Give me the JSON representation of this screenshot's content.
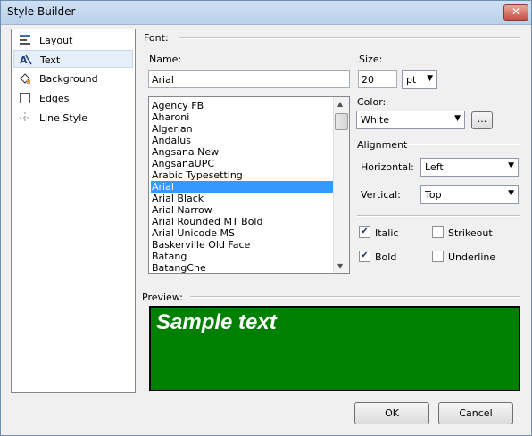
{
  "window": {
    "title": "Style Builder",
    "close_label": "✕"
  },
  "sidebar": {
    "items": [
      {
        "label": "Layout"
      },
      {
        "label": "Text"
      },
      {
        "label": "Background"
      },
      {
        "label": "Edges"
      },
      {
        "label": "Line Style"
      }
    ]
  },
  "font": {
    "group_label": "Font:",
    "name_label": "Name:",
    "name_value": "Arial",
    "size_label": "Size:",
    "size_value": "20",
    "unit_value": "pt",
    "list": [
      "Agency FB",
      "Aharoni",
      "Algerian",
      "Andalus",
      "Angsana New",
      "AngsanaUPC",
      "Arabic Typesetting",
      "Arial",
      "Arial Black",
      "Arial Narrow",
      "Arial Rounded MT Bold",
      "Arial Unicode MS",
      "Baskerville Old Face",
      "Batang",
      "BatangChe"
    ],
    "selected": "Arial"
  },
  "color": {
    "label": "Color:",
    "value": "White",
    "browse_label": "..."
  },
  "alignment": {
    "label": "Alignment",
    "horizontal_label": "Horizontal:",
    "horizontal_value": "Left",
    "vertical_label": "Vertical:",
    "vertical_value": "Top"
  },
  "styles": {
    "italic": {
      "label": "Italic",
      "checked": true
    },
    "strikeout": {
      "label": "Strikeout",
      "checked": false
    },
    "bold": {
      "label": "Bold",
      "checked": true
    },
    "underline": {
      "label": "Underline",
      "checked": false
    }
  },
  "preview": {
    "label": "Preview:",
    "text": "Sample text",
    "background": "#008000",
    "text_color": "#ffffff"
  },
  "buttons": {
    "ok": "OK",
    "cancel": "Cancel"
  }
}
